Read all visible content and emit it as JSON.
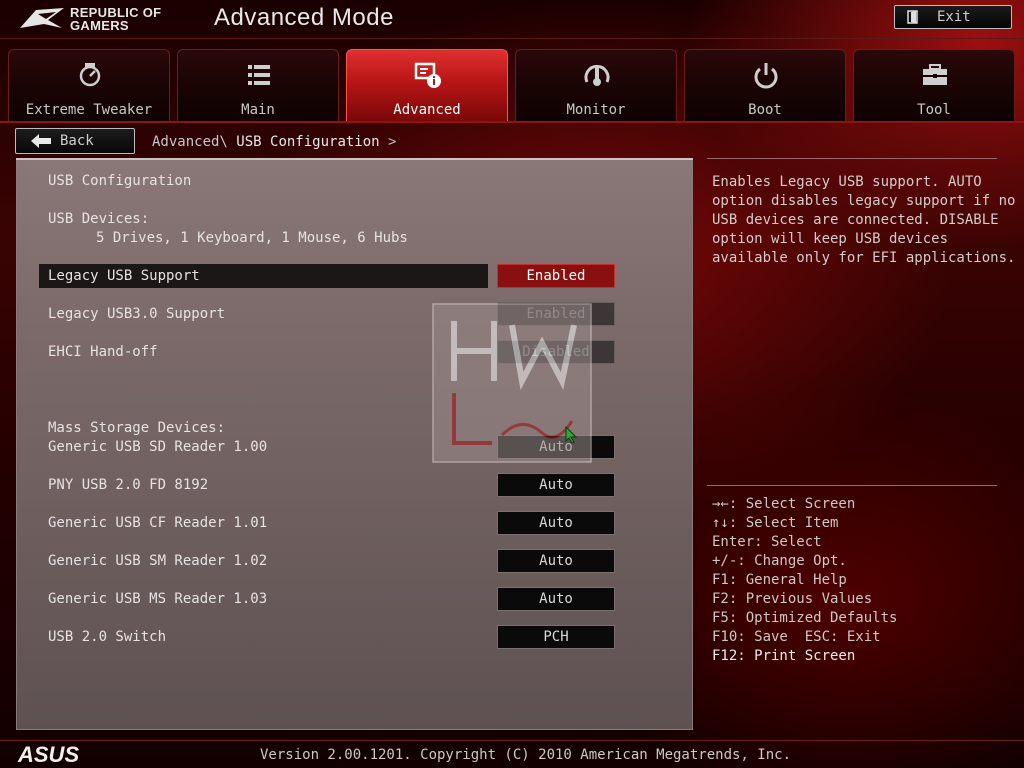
{
  "header": {
    "brand_line1": "REPUBLIC OF",
    "brand_line2": "GAMERS",
    "mode_title": "Advanced Mode",
    "exit_label": "Exit"
  },
  "tabs": [
    {
      "label": "Extreme Tweaker",
      "icon": "extreme-tweaker-icon",
      "active": false
    },
    {
      "label": "Main",
      "icon": "list-icon",
      "active": false
    },
    {
      "label": "Advanced",
      "icon": "advanced-info-icon",
      "active": true
    },
    {
      "label": "Monitor",
      "icon": "thermometer-gauge-icon",
      "active": false
    },
    {
      "label": "Boot",
      "icon": "power-icon",
      "active": false
    },
    {
      "label": "Tool",
      "icon": "toolbox-icon",
      "active": false
    }
  ],
  "navigation": {
    "back_label": "Back",
    "breadcrumb": {
      "parent": "Advanced\\",
      "current": "USB Configuration",
      "trailing": ">"
    }
  },
  "main": {
    "section_title": "USB Configuration",
    "usb_devices_label": "USB Devices:",
    "usb_devices_value": "5 Drives, 1 Keyboard, 1 Mouse, 6 Hubs",
    "mass_storage_label": "Mass Storage Devices:",
    "settings": [
      {
        "label": "Legacy USB Support",
        "value": "Enabled",
        "state": "selected"
      },
      {
        "label": "Legacy USB3.0 Support",
        "value": "Enabled",
        "state": "disabled"
      },
      {
        "label": "EHCI Hand-off",
        "value": "Disabled",
        "state": "disabled"
      },
      {
        "label": "Generic USB SD Reader 1.00",
        "value": "Auto",
        "state": "normal"
      },
      {
        "label": "PNY USB 2.0 FD 8192",
        "value": "Auto",
        "state": "normal"
      },
      {
        "label": "Generic USB CF Reader 1.01",
        "value": "Auto",
        "state": "normal"
      },
      {
        "label": "Generic USB SM Reader 1.02",
        "value": "Auto",
        "state": "normal"
      },
      {
        "label": "Generic USB MS Reader 1.03",
        "value": "Auto",
        "state": "normal"
      },
      {
        "label": "USB 2.0 Switch",
        "value": "PCH",
        "state": "normal"
      }
    ]
  },
  "help": {
    "description": "Enables Legacy USB support. AUTO\noption disables legacy support if no\nUSB devices are connected. DISABLE\noption will keep USB devices\navailable only for EFI applications.",
    "keys": [
      "→←: Select Screen",
      "↑↓: Select Item",
      "Enter: Select",
      "+/-: Change Opt.",
      "F1: General Help",
      "F2: Previous Values",
      "F5: Optimized Defaults",
      "F10: Save  ESC: Exit",
      "F12: Print Screen"
    ]
  },
  "footer": {
    "brand": "ASUS",
    "version": "Version 2.00.1201. Copyright (C) 2010 American Megatrends, Inc."
  },
  "colors": {
    "accent_red": "#b81515",
    "selected_value_bg": "#8a1010",
    "panel_bg": "#7c6a6a"
  }
}
